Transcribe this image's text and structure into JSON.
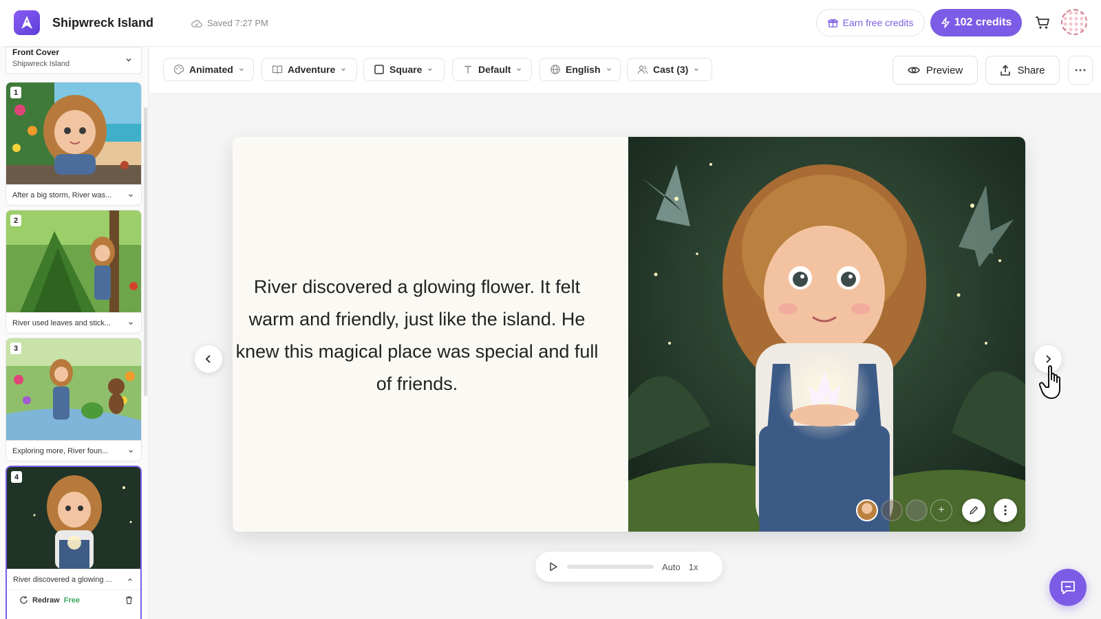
{
  "app": {
    "title": "Shipwreck Island",
    "saved": "Saved 7:27 PM"
  },
  "header": {
    "earn_credits": "Earn free credits",
    "credits": "102 credits"
  },
  "sidebar": {
    "cover": {
      "title": "Front Cover",
      "subtitle": "Shipwreck Island"
    },
    "pages": [
      {
        "number": "1",
        "caption": "After a big storm, River was..."
      },
      {
        "number": "2",
        "caption": "River used leaves and stick..."
      },
      {
        "number": "3",
        "caption": "Exploring more, River foun..."
      },
      {
        "number": "4",
        "caption": "River discovered a glowing ...",
        "redraw": "Redraw",
        "free": "Free"
      }
    ]
  },
  "toolbar": {
    "style": "Animated",
    "genre": "Adventure",
    "format": "Square",
    "font": "Default",
    "language": "English",
    "cast": "Cast (3)",
    "preview": "Preview",
    "share": "Share"
  },
  "book": {
    "lines": [
      "River discovered a glowing flower. It felt",
      "warm and friendly, just like the island. He",
      "knew this magical place was special and full",
      "of friends."
    ]
  },
  "player": {
    "mode": "Auto",
    "speed": "1x"
  },
  "colors": {
    "accent": "#7c5ce6",
    "free": "#3ca55c"
  }
}
